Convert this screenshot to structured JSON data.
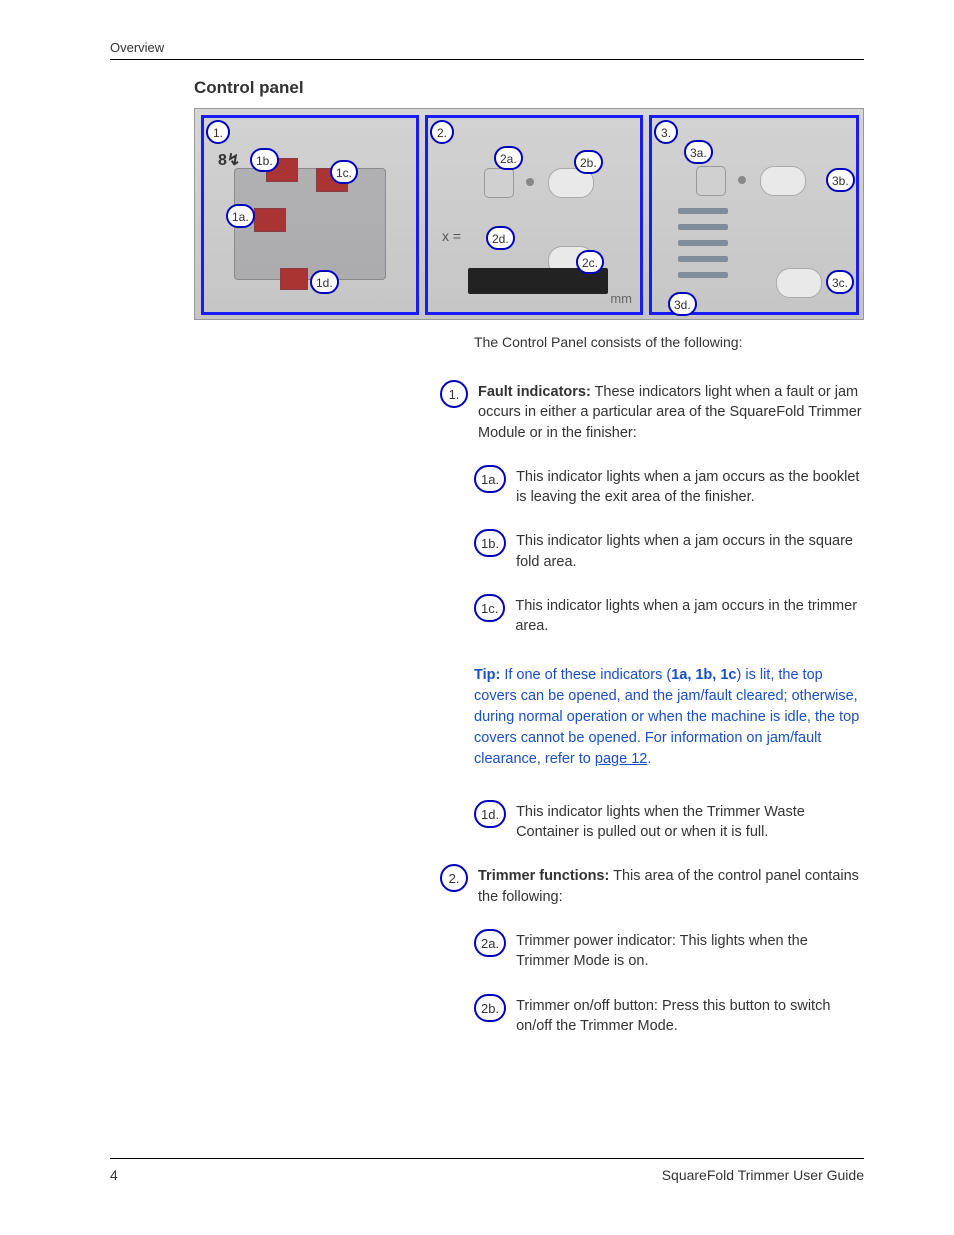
{
  "header": {
    "section": "Overview"
  },
  "title": "Control panel",
  "intro": "The Control Panel consists of the following:",
  "img": {
    "mm": "mm",
    "callouts": {
      "c1": "1.",
      "c1a": "1a.",
      "c1b": "1b.",
      "c1c": "1c.",
      "c1d": "1d.",
      "c2": "2.",
      "c2a": "2a.",
      "c2b": "2b.",
      "c2c": "2c.",
      "c2d": "2d.",
      "c3": "3.",
      "c3a": "3a.",
      "c3b": "3b.",
      "c3c": "3c.",
      "c3d": "3d."
    }
  },
  "items": {
    "i1": {
      "num": "1.",
      "bold": "Fault indicators:",
      "text": " These indicators light when a fault or jam occurs in either a particular area of the SquareFold Trimmer Module or in the finisher:"
    },
    "i1a": {
      "num": "1a.",
      "text": "This indicator lights when a jam occurs as the booklet is leaving the exit area of the finisher."
    },
    "i1b": {
      "num": "1b.",
      "text": "This indicator lights when a jam occurs in the square fold area."
    },
    "i1c": {
      "num": "1c.",
      "text": "This indicator lights when a jam occurs in the trimmer area."
    },
    "i1d": {
      "num": "1d.",
      "text": "This indicator lights when the Trimmer Waste Container is pulled out or when it is full."
    },
    "i2": {
      "num": "2.",
      "bold": "Trimmer functions:",
      "text": " This area of the control panel contains the following:"
    },
    "i2a": {
      "num": "2a.",
      "text": "Trimmer power indicator: This lights when the Trimmer Mode is on."
    },
    "i2b": {
      "num": "2b.",
      "text": "Trimmer on/off button: Press this button to switch on/off the Trimmer Mode."
    }
  },
  "tip": {
    "label": "Tip:",
    "before": "  If one of these indicators (",
    "boldrefs": "1a, 1b, 1c",
    "middle": ") is lit, the top covers can be opened, and the jam/fault cleared; otherwise, during normal operation or when the machine is idle, the top covers cannot be opened. For information on jam/fault clearance, refer to ",
    "link": "page 12",
    "after": "."
  },
  "footer": {
    "page": "4",
    "doc": "SquareFold Trimmer User Guide"
  }
}
